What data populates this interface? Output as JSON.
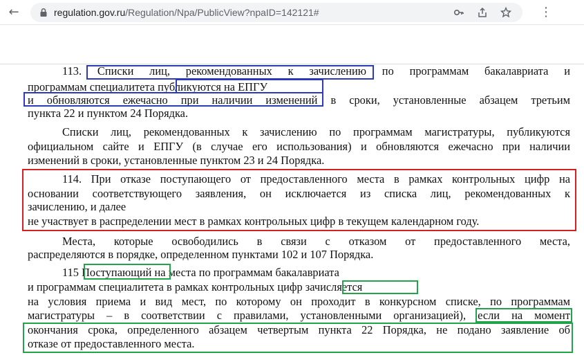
{
  "browser": {
    "url_host": "regulation.gov.ru",
    "url_path": "/Regulation/Npa/PublicView?npaID=142121#",
    "icons": [
      "back-arrow-icon",
      "lock-icon",
      "key-icon",
      "share-icon",
      "star-icon",
      "menu-icon"
    ]
  },
  "document": {
    "p113": {
      "l1": "113. Списки лиц, рекомендованных к зачислению по программам бакалавриата и",
      "l2": "программам специалитета публикуются на ЕПГУ",
      "l3": "и обновляются ежечасно при наличии изменений в сроки, установленные абзацем третьим",
      "l4": "пункта 22 и пунктом 24 Порядка."
    },
    "p113b": {
      "l1": "Списки лиц, рекомендованных к зачислению по программам магистратуры, публикуются",
      "l2": "официальном сайте и ЕПГУ (в случае его использования) и обновляются ежечасно при наличии",
      "l3": "изменений в сроки, установленные пунктом 23 и 24 Порядка."
    },
    "p114": {
      "l1": "114. При отказе поступающего от предоставленного места в рамках контрольных цифр на",
      "l2": "основании соответствующего заявления, он исключается из списка лиц, рекомендованных к",
      "l3": "зачислению, и далее",
      "l4": "не участвует в распределении мест в рамках контрольных цифр в текущем календарном году."
    },
    "p114b": {
      "l1": "Места, которые освободились в связи с отказом от предоставленного места,",
      "l2": "распределяются в порядке, определенном пунктами 102 и 107 Порядка."
    },
    "p115": {
      "l1": "115 Поступающий на места по программам бакалавриата",
      "l2": "и программам специалитета в рамках контрольных цифр зачисляется",
      "l3": "на условия приема и вид мест, по которому он проходит в конкурсном списке, по программам",
      "l4": "магистратуры – в соответствии с правилами, установленными организацией), если на момент",
      "l5": "окончания срока, определенного абзацем четвертым пункта 22 Порядка, не подано заявление об",
      "l6": "отказе от предоставленного места."
    }
  },
  "highlight_colors": {
    "blue": "#2b3ab8",
    "red": "#d62020",
    "green": "#22a34a"
  }
}
